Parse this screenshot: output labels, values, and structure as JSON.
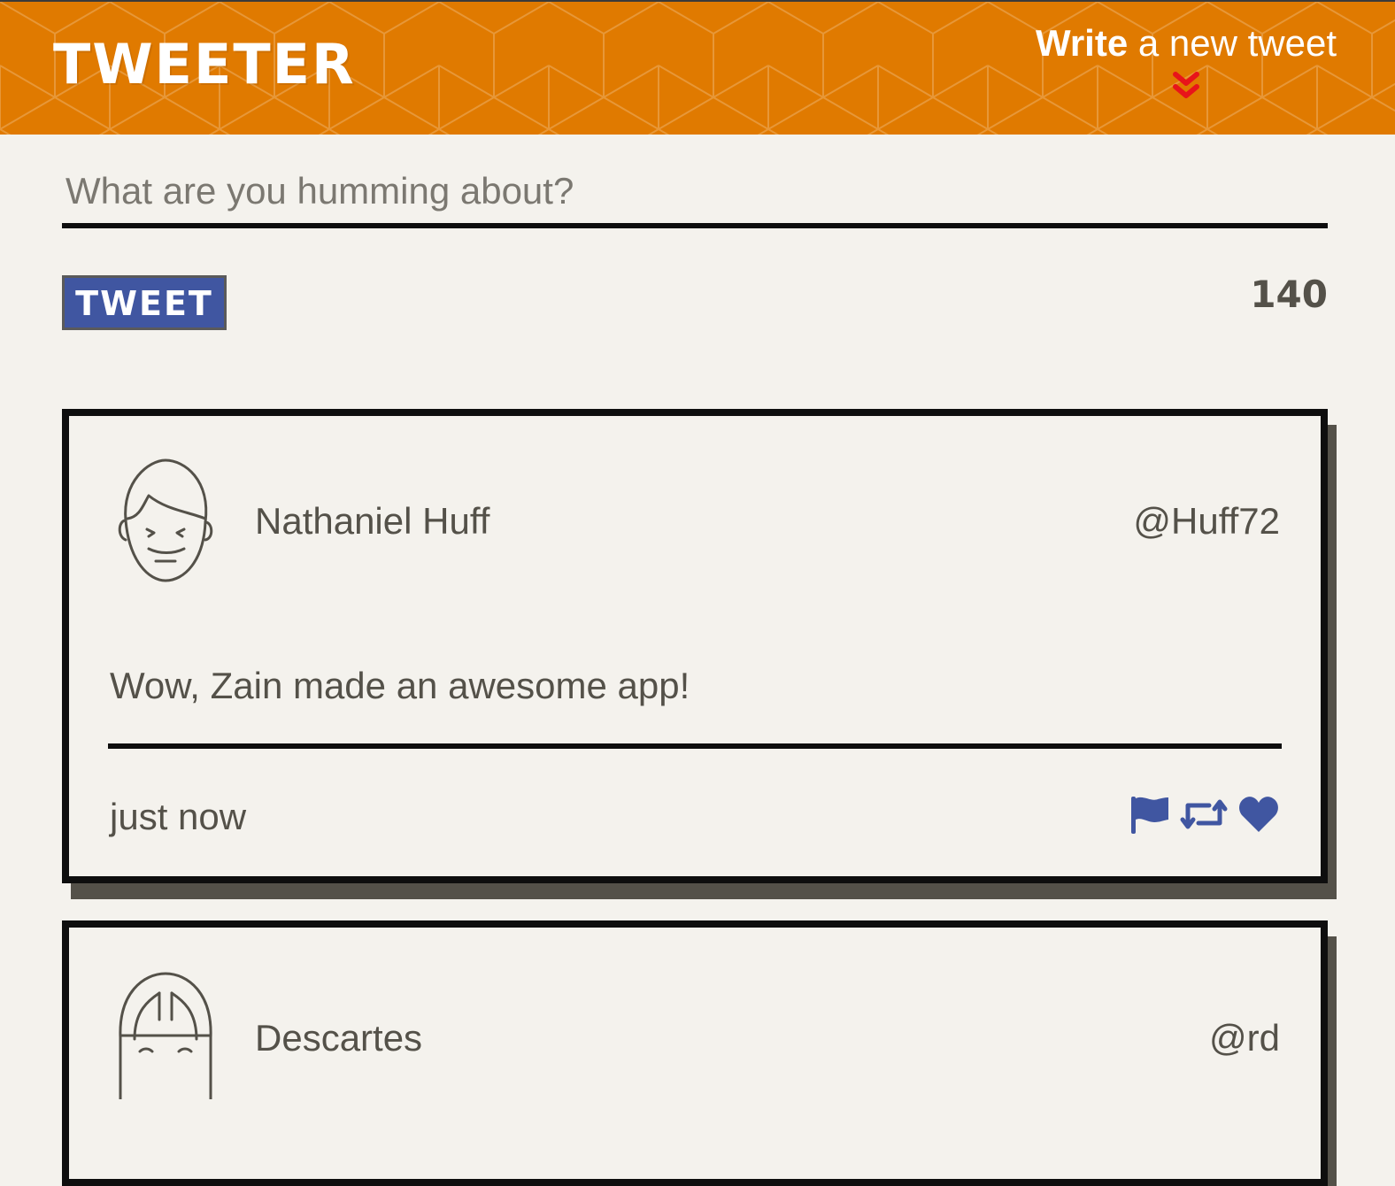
{
  "header": {
    "brand": "TWEETER",
    "compose_toggle": {
      "strong": "Write",
      "rest": " a new tweet",
      "icon": "double-chevron-down-icon"
    }
  },
  "composer": {
    "placeholder": "What are you humming about?",
    "value": "",
    "button_label": "TWEET",
    "char_count": "140"
  },
  "tweets": [
    {
      "name": "Nathaniel Huff",
      "handle": "@Huff72",
      "content": "Wow, Zain made an awesome app!",
      "time": "just now",
      "avatar": "male-face-avatar",
      "actions": [
        "flag-icon",
        "retweet-icon",
        "heart-icon"
      ]
    },
    {
      "name": "Descartes",
      "handle": "@rd",
      "avatar": "bob-hair-avatar"
    }
  ],
  "colors": {
    "header": "#e07a00",
    "background": "#f4f2ed",
    "accent_blue": "#4056a1",
    "chevron_red": "#e8141a",
    "text": "#545149",
    "border": "#0e0e0e",
    "shadow": "#545149"
  }
}
